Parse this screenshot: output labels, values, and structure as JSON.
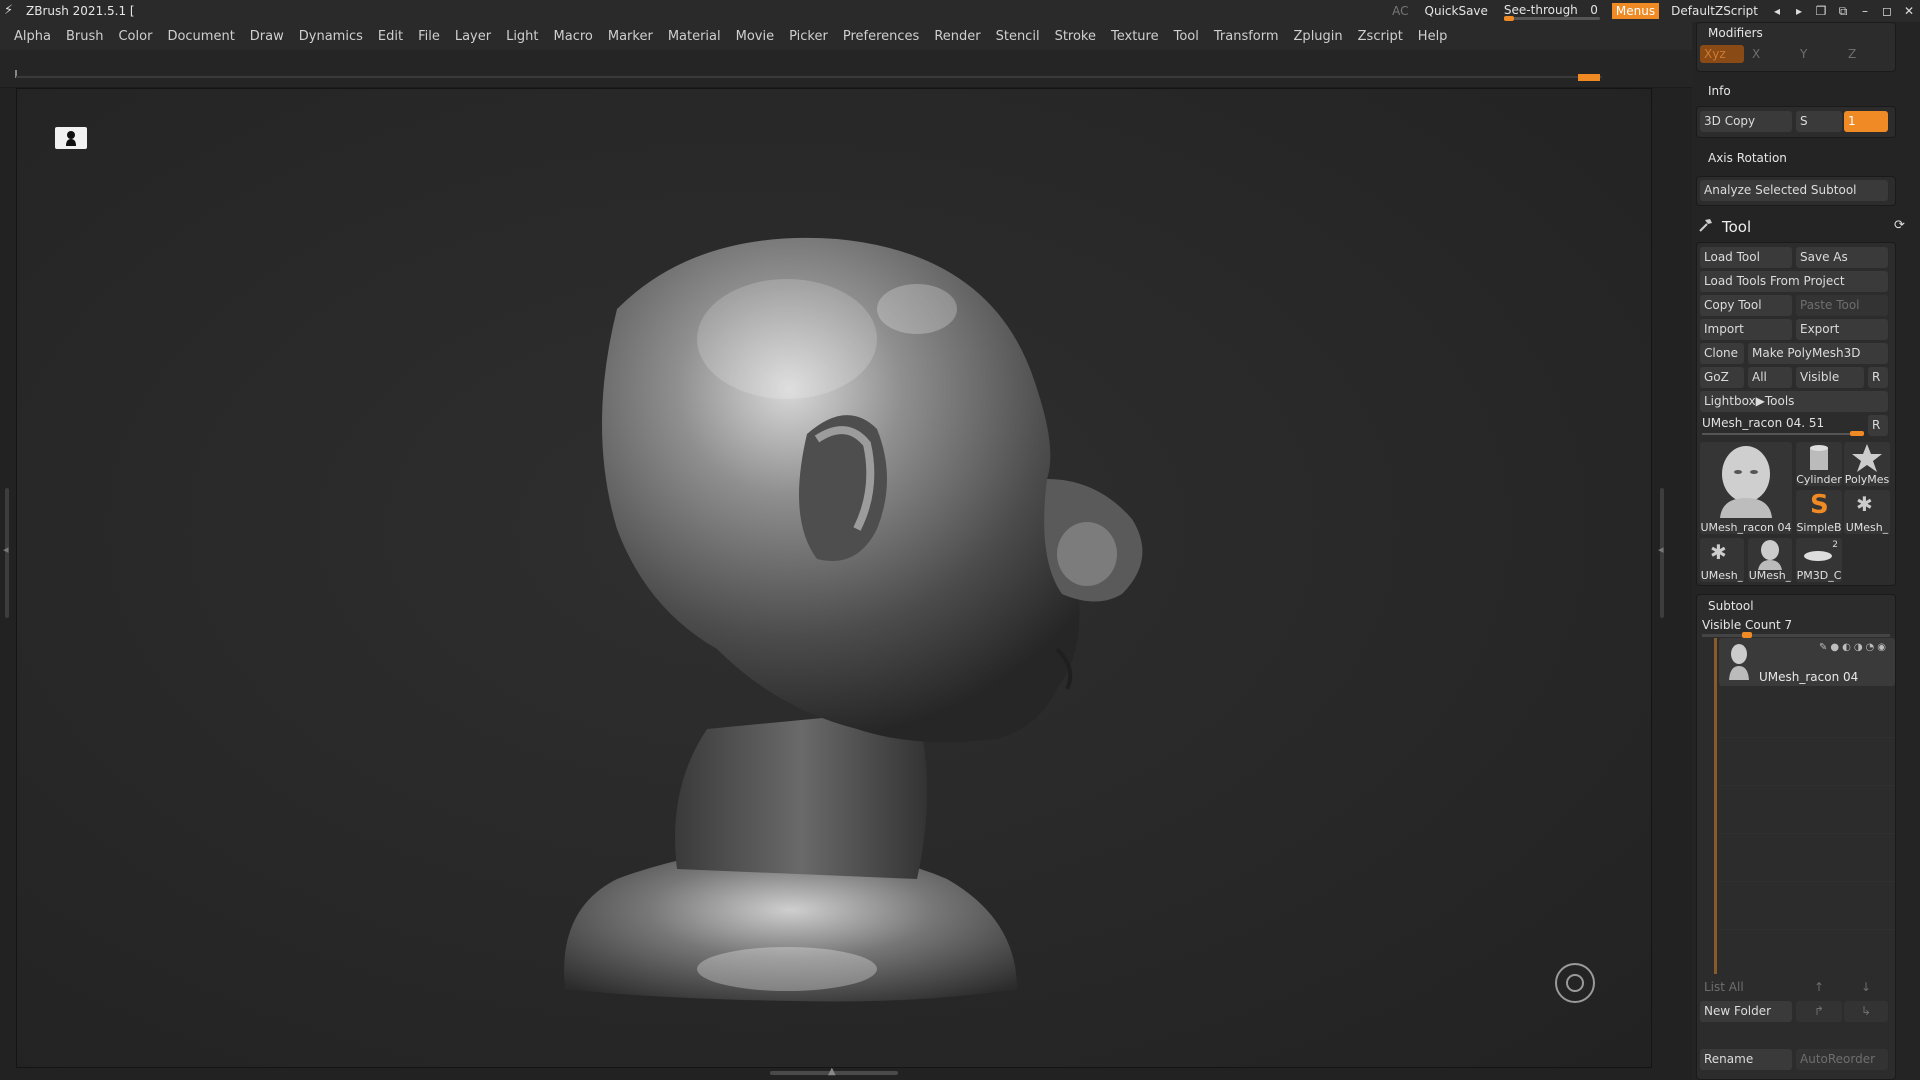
{
  "titlebar": {
    "app_title": "ZBrush 2021.5.1 [",
    "ac": "AC",
    "quicksave": "QuickSave",
    "see_through_label": "See-through",
    "see_through_value": "0",
    "menus": "Menus",
    "default_zscript": "DefaultZScript"
  },
  "menubar": {
    "items": [
      "Alpha",
      "Brush",
      "Color",
      "Document",
      "Draw",
      "Dynamics",
      "Edit",
      "File",
      "Layer",
      "Light",
      "Macro",
      "Marker",
      "Material",
      "Movie",
      "Picker",
      "Preferences",
      "Render",
      "Stencil",
      "Stroke",
      "Texture",
      "Tool",
      "Transform",
      "Zplugin",
      "Zscript",
      "Help"
    ]
  },
  "tray": {
    "modifiers_title": "Modifiers",
    "modifier_buttons": [
      "Xyz",
      "X",
      "Y",
      "Z"
    ],
    "info_title": "Info",
    "copy_3d": "3D Copy",
    "s_label": "S",
    "s_value": "1",
    "axis_rotation": "Axis Rotation",
    "analyze_subtool": "Analyze Selected Subtool"
  },
  "tool": {
    "title": "Tool",
    "load_tool": "Load Tool",
    "save_as": "Save As",
    "load_from_project": "Load Tools From Project",
    "copy_tool": "Copy Tool",
    "paste_tool": "Paste Tool",
    "import": "Import",
    "export": "Export",
    "clone": "Clone",
    "make_polymesh": "Make PolyMesh3D",
    "goz": "GoZ",
    "all": "All",
    "visible": "Visible",
    "r": "R",
    "lightbox_tools": "Lightbox▶Tools",
    "current_tool": "UMesh_racon 04. 51",
    "thumbnails": [
      {
        "label": "UMesh_racon 04",
        "badge": ""
      },
      {
        "label": "Cylinder",
        "badge": ""
      },
      {
        "label": "PolyMes",
        "badge": ""
      },
      {
        "label": "SimpleB",
        "badge": ""
      },
      {
        "label": "UMesh_",
        "badge": ""
      },
      {
        "label": "UMesh_",
        "badge": ""
      },
      {
        "label": "UMesh_",
        "badge": ""
      },
      {
        "label": "PM3D_C",
        "badge": "2"
      }
    ]
  },
  "subtool": {
    "title": "Subtool",
    "visible_count": "Visible Count 7",
    "items": [
      {
        "name": "UMesh_racon 04"
      }
    ],
    "list_all": "List All",
    "new_folder": "New Folder",
    "rename": "Rename",
    "auto_reorder": "AutoReorder"
  }
}
